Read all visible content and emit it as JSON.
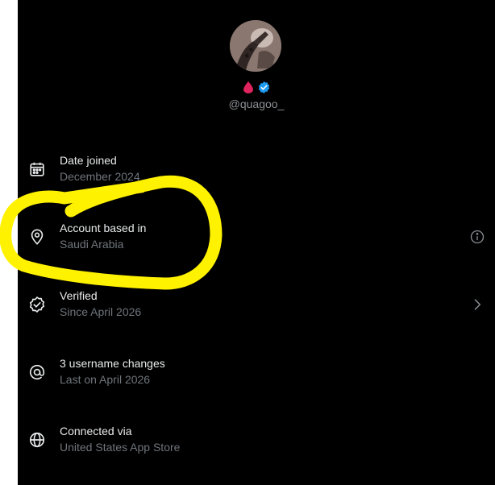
{
  "profile": {
    "handle": "@quagoo_",
    "badges": [
      "blood-drop-icon",
      "verified-badge-icon"
    ]
  },
  "rows": [
    {
      "title": "Date joined",
      "subtitle": "December 2024",
      "icon": "calendar-icon"
    },
    {
      "title": "Account based in",
      "subtitle": "Saudi Arabia",
      "icon": "location-pin-icon",
      "trailing": "info-icon"
    },
    {
      "title": "Verified",
      "subtitle": "Since April 2026",
      "icon": "verified-check-icon",
      "trailing": "chevron-right-icon"
    },
    {
      "title": "3 username changes",
      "subtitle": "Last on April 2026",
      "icon": "at-sign-icon"
    },
    {
      "title": "Connected via",
      "subtitle": "United States App Store",
      "icon": "globe-icon"
    }
  ],
  "colors": {
    "background": "#000000",
    "primary_text": "#e7e9ea",
    "secondary_text": "#6f757b",
    "verified_blue": "#1d9bf0",
    "drop_red": "#e0245e",
    "annotation_yellow": "#fff200"
  }
}
